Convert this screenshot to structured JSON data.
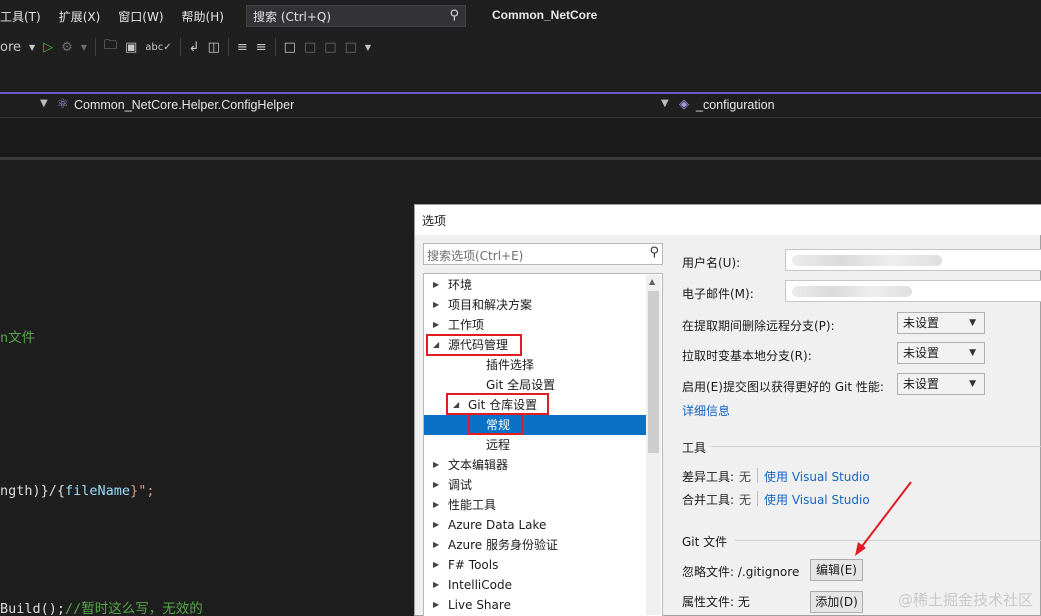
{
  "menubar": {
    "items": [
      "工具(T)",
      "扩展(X)",
      "窗口(W)",
      "帮助(H)"
    ],
    "search_label": "搜索 (Ctrl+Q)",
    "window_title": "Common_NetCore"
  },
  "toolbar": {
    "partial_text": "ore"
  },
  "navbar": {
    "class_path": "Common_NetCore.Helper.ConfigHelper",
    "member": "_configuration"
  },
  "editor": {
    "lines": [
      {
        "text": "n文件",
        "kind": "comment"
      },
      {
        "text_a": "ngth)}/{",
        "text_var": "fileName",
        "text_b": "}\";"
      },
      {
        "text_a": "Build();",
        "text_comment": "//暂时这么写，无效的"
      }
    ]
  },
  "dialog": {
    "title": "选项",
    "search_placeholder": "搜索选项(Ctrl+E)",
    "tree": [
      {
        "label": "环境",
        "level": 0,
        "expanded": false
      },
      {
        "label": "项目和解决方案",
        "level": 0,
        "expanded": false
      },
      {
        "label": "工作项",
        "level": 0,
        "expanded": false
      },
      {
        "label": "源代码管理",
        "level": 0,
        "expanded": true
      },
      {
        "label": "插件选择",
        "level": 1,
        "leaf": true
      },
      {
        "label": "Git 全局设置",
        "level": 1,
        "leaf": true
      },
      {
        "label": "Git 仓库设置",
        "level": 1,
        "expanded": true
      },
      {
        "label": "常规",
        "level": 2,
        "leaf": true,
        "selected": true
      },
      {
        "label": "远程",
        "level": 2,
        "leaf": true
      },
      {
        "label": "文本编辑器",
        "level": 0,
        "expanded": false
      },
      {
        "label": "调试",
        "level": 0,
        "expanded": false
      },
      {
        "label": "性能工具",
        "level": 0,
        "expanded": false
      },
      {
        "label": "Azure Data Lake",
        "level": 0,
        "expanded": false
      },
      {
        "label": "Azure 服务身份验证",
        "level": 0,
        "expanded": false
      },
      {
        "label": "F# Tools",
        "level": 0,
        "expanded": false
      },
      {
        "label": "IntelliCode",
        "level": 0,
        "expanded": false
      },
      {
        "label": "Live Share",
        "level": 0,
        "expanded": false
      }
    ],
    "settings": {
      "username_label": "用户名(U):",
      "email_label": "电子邮件(M):",
      "prune_label": "在提取期间删除远程分支(P):",
      "prune_value": "未设置",
      "rebase_label": "拉取时变基本地分支(R):",
      "rebase_value": "未设置",
      "commitgraph_label": "启用(E)提交图以获得更好的 Git 性能:",
      "commitgraph_value": "未设置",
      "details_link": "详细信息",
      "tools_section": "工具",
      "diff_label": "差异工具:",
      "diff_value": "无",
      "diff_link": "使用 Visual Studio",
      "merge_label": "合并工具:",
      "merge_value": "无",
      "merge_link": "使用 Visual Studio",
      "gitfiles_section": "Git 文件",
      "ignore_label": "忽略文件: /.gitignore",
      "edit_button": "编辑(E)",
      "attr_label": "属性文件: 无",
      "add_button": "添加(D)"
    }
  },
  "watermark": "@稀土掘金技术社区",
  "colors": {
    "accent_selected": "#0a72c6",
    "highlight_red": "#e31b23",
    "link_blue": "#1463c4",
    "comment_green": "#57a64a"
  }
}
